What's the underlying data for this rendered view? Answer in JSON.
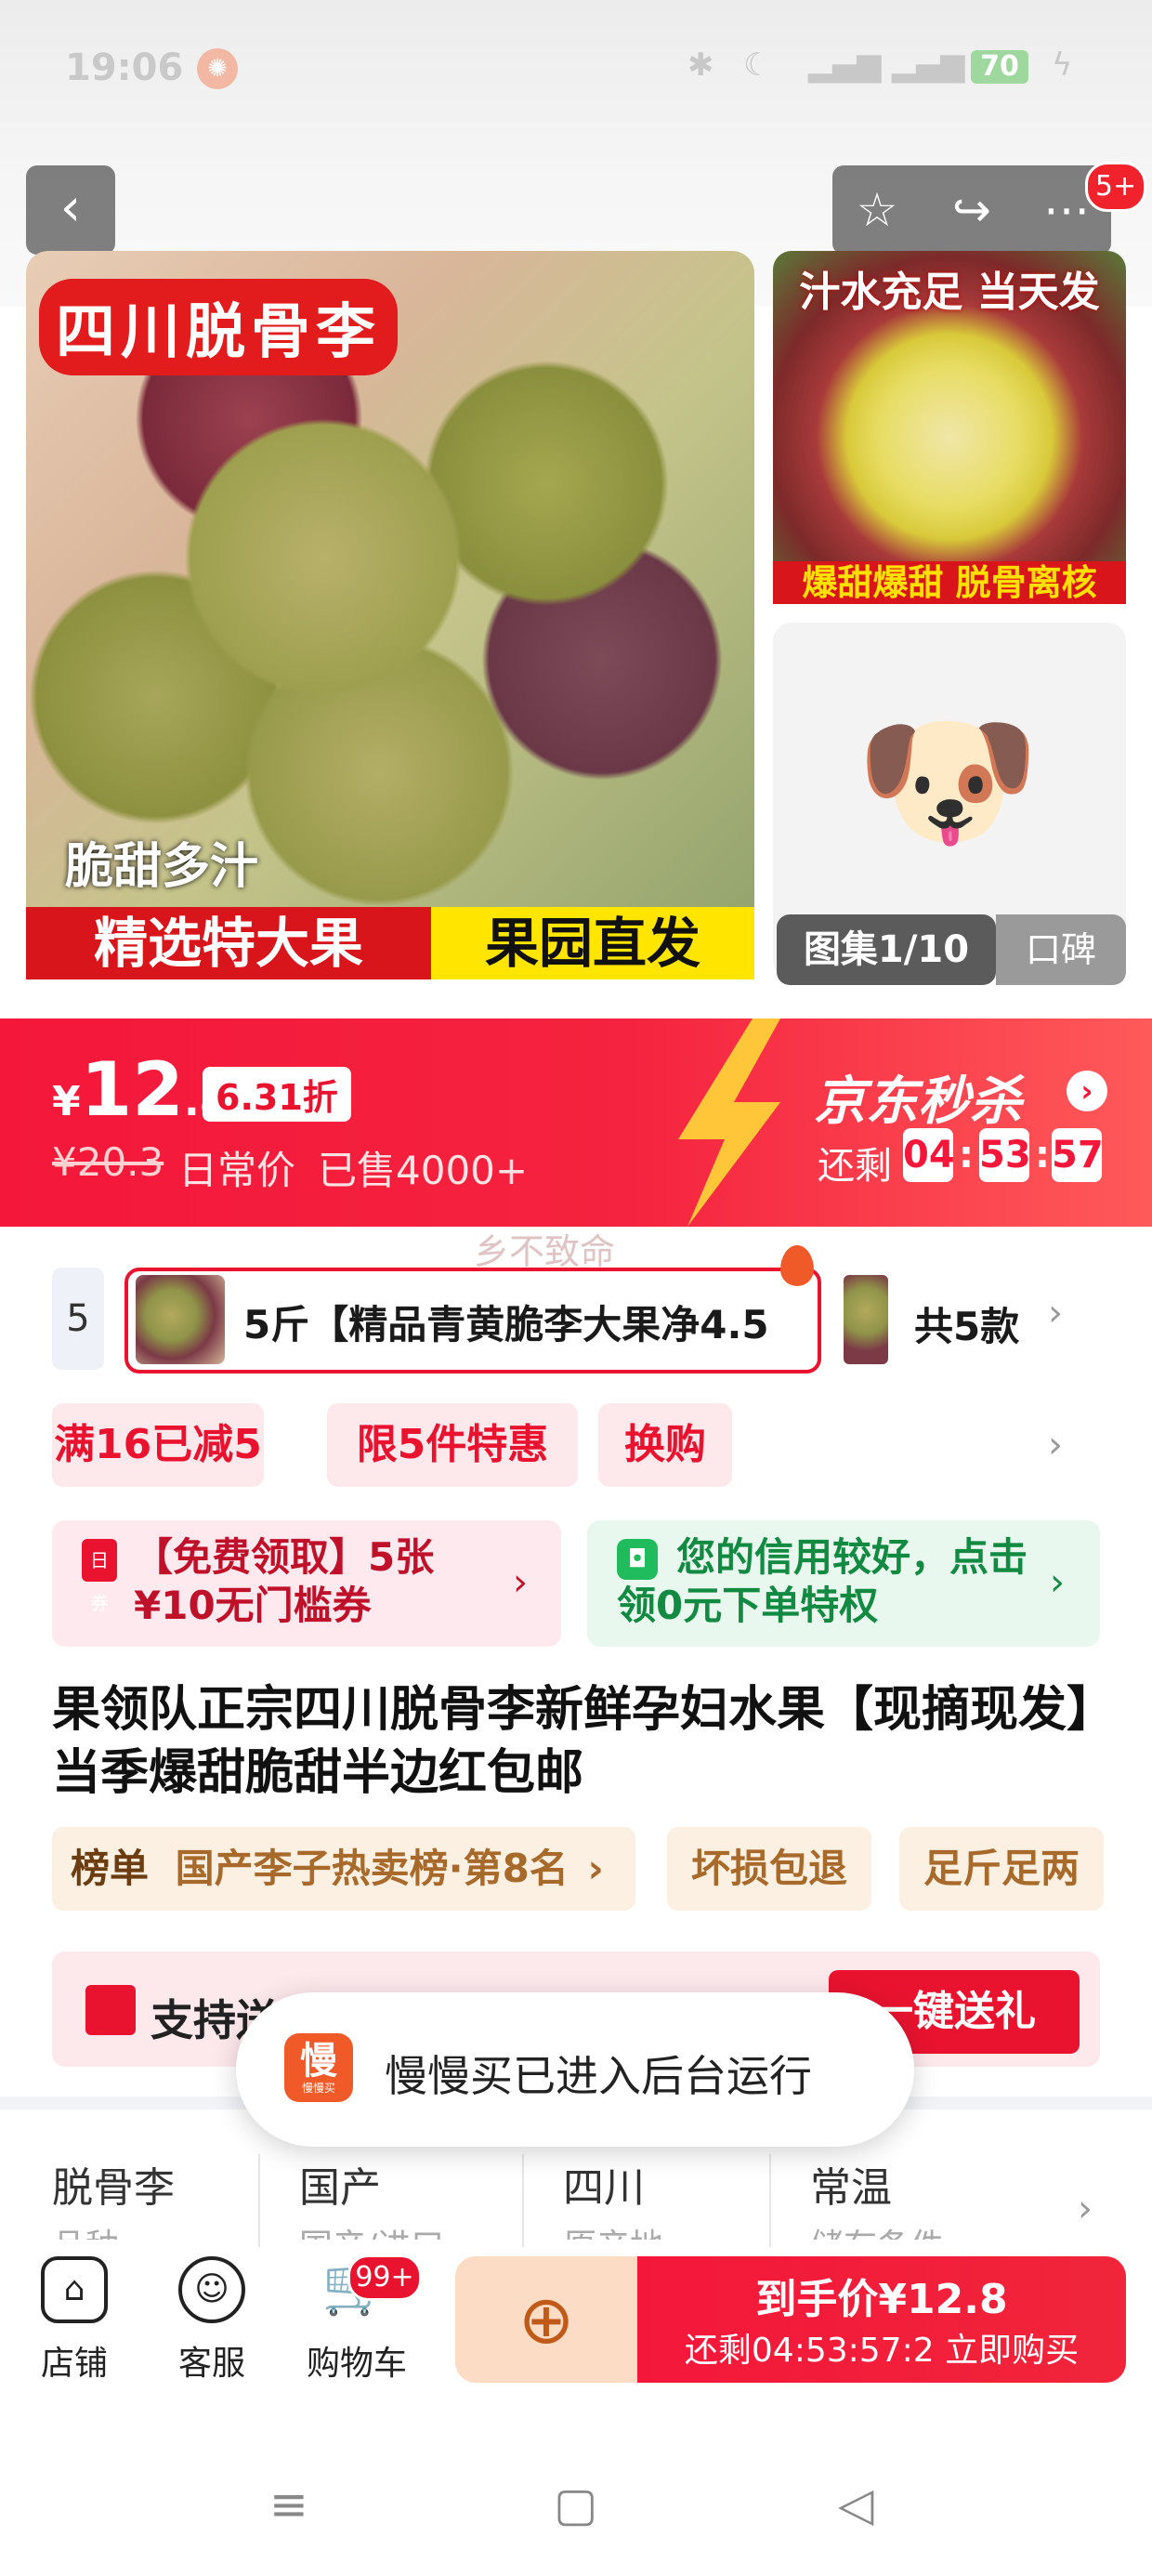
{
  "status_bar": {
    "time": "19:06",
    "battery": "70"
  },
  "header": {
    "notification_count": "5+"
  },
  "gallery": {
    "main_tag": "四川脱骨李",
    "main_caption": "脆甜多汁",
    "main_banner_left": "精选特大果",
    "main_banner_right": "果园直发",
    "side1_top": "汁水充足 当天发",
    "side1_bottom": "爆甜爆甜 脱骨离核",
    "counter": "图集1/10",
    "review_tab": "口碑"
  },
  "price_banner": {
    "currency": "¥",
    "price_int": "12",
    "price_dec": ".8",
    "discount": "6.31折",
    "original_price": "¥20.3",
    "original_label": "日常价",
    "sold": "已售4000+",
    "seckill_title": "京东秒杀",
    "remain_label": "还剩",
    "countdown_h": "04",
    "countdown_m": "53",
    "countdown_s": "57",
    "watermark": "乡不致命"
  },
  "sku": {
    "prev_partial": "5",
    "selected_label": "5斤【精品青黄脆李大果净4.5",
    "total": "共5款"
  },
  "promos": [
    "满16已减5",
    "限5件特惠",
    "换购"
  ],
  "coupons": {
    "left_icon": "日券",
    "left_text": "【免费领取】5张¥10无门槛券",
    "right_text": "您的信用较好，点击领0元下单特权"
  },
  "product_title": "果领队正宗四川脱骨李新鲜孕妇水果【现摘现发】当季爆甜脆甜半边红包邮",
  "tags": {
    "rank_label": "榜单",
    "rank_text": "国产李子热卖榜·第8名",
    "tag2": "坏损包退",
    "tag3": "足斤足两"
  },
  "gift": {
    "text": "支持送",
    "button": "一键送礼"
  },
  "toast": {
    "icon_char": "慢",
    "icon_sub": "慢慢买",
    "text": "慢慢买已进入后台运行"
  },
  "specs": [
    {
      "value": "脱骨李",
      "label": "品种"
    },
    {
      "value": "国产",
      "label": "国产/进口"
    },
    {
      "value": "四川",
      "label": "原产地"
    },
    {
      "value": "常温",
      "label": "储存条件"
    }
  ],
  "bottom_bar": {
    "shop": "店铺",
    "service": "客服",
    "cart": "购物车",
    "cart_badge": "99+",
    "buy_line1": "到手价¥12.8",
    "buy_line2": "还剩04:53:57:2  立即购买"
  },
  "colors": {
    "jd_red": "#f4173a",
    "promo_bg": "#fde8ec",
    "green_card": "#e8f8ee",
    "tag_bg": "#fbf0e2"
  }
}
